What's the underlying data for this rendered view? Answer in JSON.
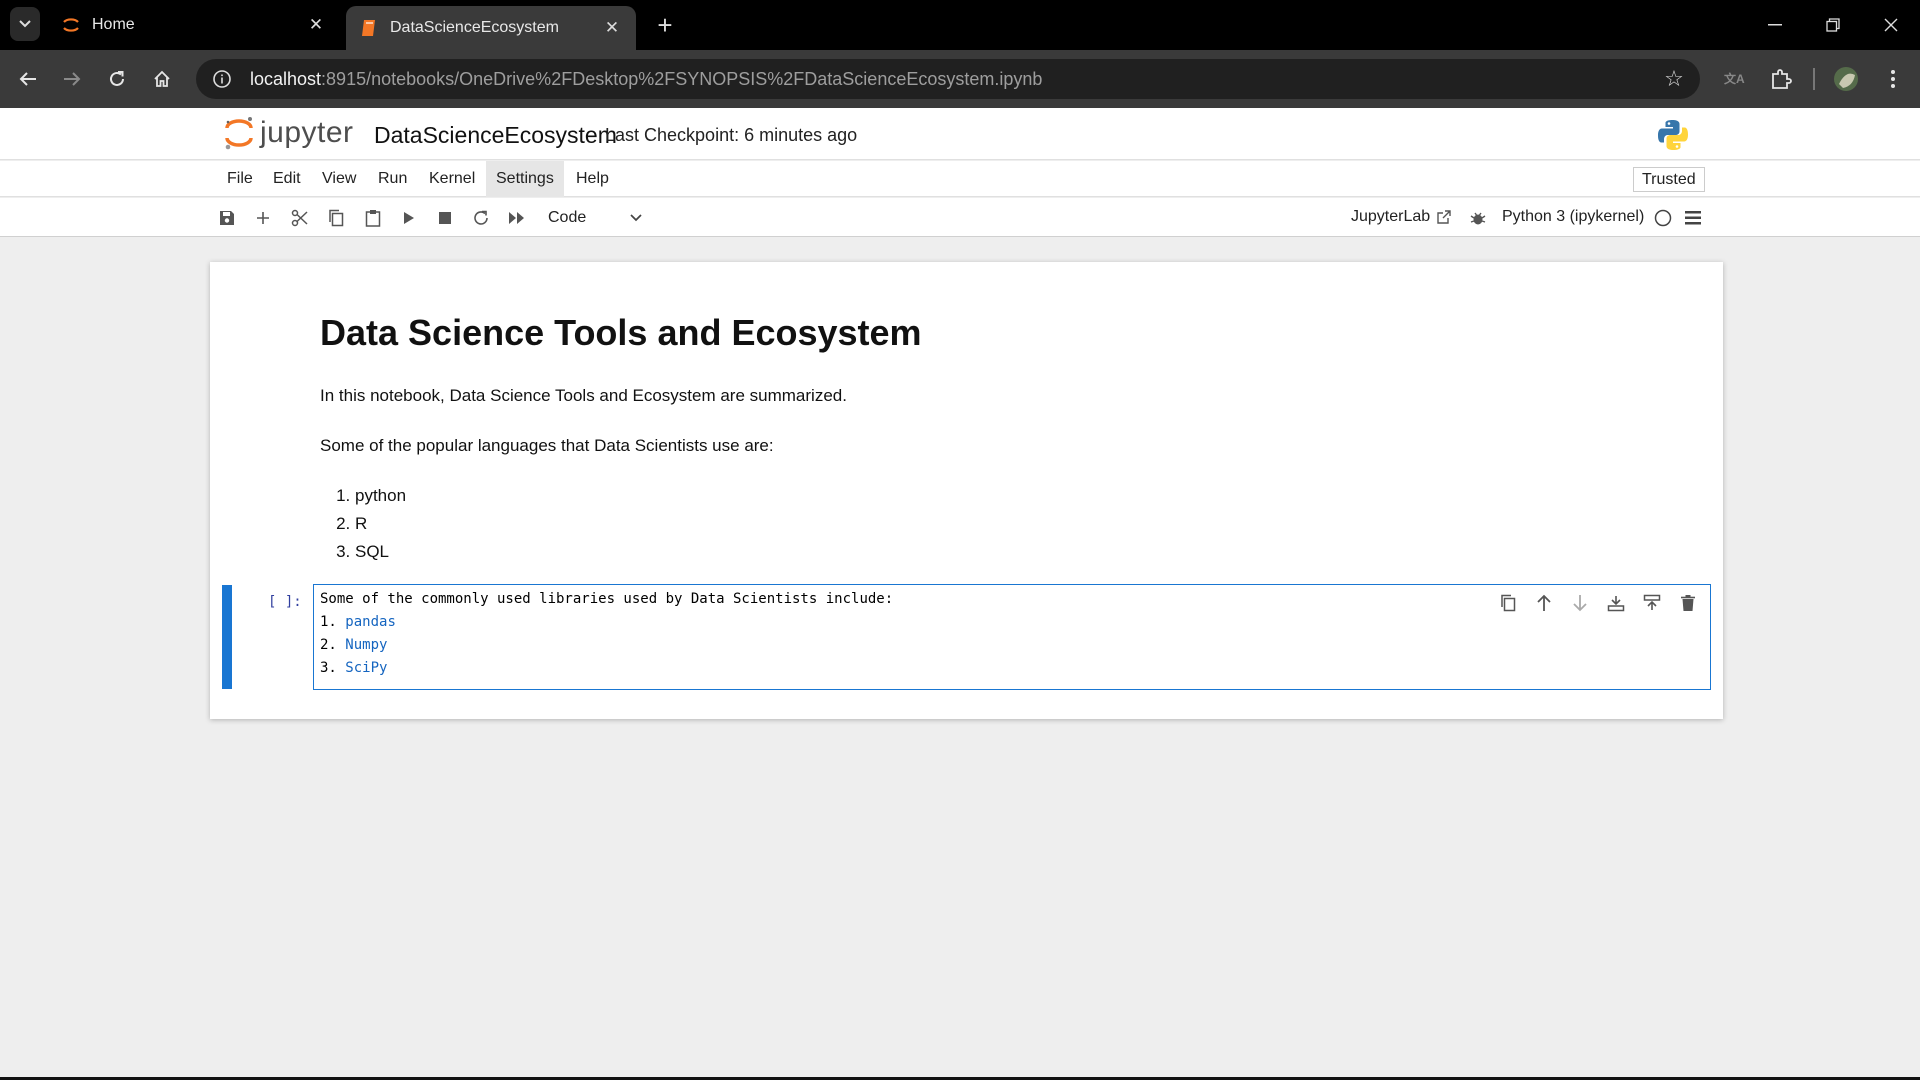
{
  "browser": {
    "tabs": [
      {
        "title": "Home",
        "active": false
      },
      {
        "title": "DataScienceEcosystem",
        "active": true
      }
    ],
    "url_host": "localhost",
    "url_path": ":8915/notebooks/OneDrive%2FDesktop%2FSYNOPSIS%2FDataScienceEcosystem.ipynb"
  },
  "jupyter": {
    "logo_text": "jupyter",
    "notebook_title": "DataScienceEcosystem",
    "checkpoint": "Last Checkpoint: 6 minutes ago",
    "menu": [
      "File",
      "Edit",
      "View",
      "Run",
      "Kernel",
      "Settings",
      "Help"
    ],
    "trusted": "Trusted",
    "cell_type": "Code",
    "jupyterlab_label": "JupyterLab",
    "kernel_name": "Python 3 (ipykernel)"
  },
  "markdown_cell": {
    "heading": "Data Science Tools and Ecosystem",
    "intro": "In this notebook, Data Science Tools and Ecosystem are summarized.",
    "languages_intro": "Some of the popular languages that Data Scientists use are:",
    "languages": [
      "python",
      "R",
      "SQL"
    ]
  },
  "code_cell": {
    "prompt": "[ ]:",
    "line1": "Some of the commonly used libraries used by Data Scientists include:",
    "libraries": [
      {
        "num": "1.",
        "name": "pandas"
      },
      {
        "num": "2.",
        "name": "Numpy"
      },
      {
        "num": "3.",
        "name": "SciPy"
      }
    ]
  },
  "colors": {
    "accent": "#1976d2",
    "jupyter_orange": "#f37726"
  }
}
